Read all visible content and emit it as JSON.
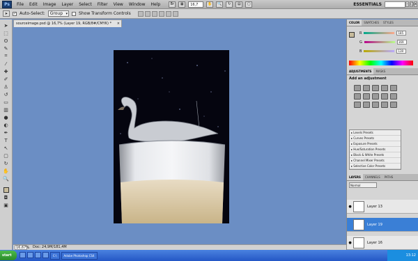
{
  "app": {
    "logo": "Ps"
  },
  "menu": {
    "items": [
      "File",
      "Edit",
      "Image",
      "Layer",
      "Select",
      "Filter",
      "View",
      "Window",
      "Help"
    ],
    "zoom": "16,7",
    "workspace": "ESSENTIALS",
    "window_controls": [
      "-",
      "□",
      "x"
    ]
  },
  "options": {
    "auto_select_label": "Auto-Select:",
    "auto_select_checked": "✓",
    "auto_select_value": "Group",
    "transform_label": "Show Transform Controls"
  },
  "document": {
    "tab_title": "sourceimage.psd @ 16,7% (Layer 19, RGB/8#/CMYK) *",
    "close": "×"
  },
  "status": {
    "zoom": "16,67%",
    "doc_info": "Doc: 24,9M/181,4M"
  },
  "color_panel": {
    "tabs": [
      "COLOR",
      "SWATCHES",
      "STYLES"
    ],
    "fg_color": "#c8bc9c",
    "channels": [
      {
        "label": "R",
        "value": "185"
      },
      {
        "label": "G",
        "value": "169"
      },
      {
        "label": "B",
        "value": "139"
      }
    ]
  },
  "adjustments": {
    "tabs": [
      "ADJUSTMENTS",
      "MASKS"
    ],
    "title": "Add an adjustment",
    "presets": [
      "Levels Presets",
      "Curves Presets",
      "Exposure Presets",
      "Hue/Saturation Presets",
      "Black & White Presets",
      "Channel Mixer Presets",
      "Selective Color Presets"
    ]
  },
  "layers": {
    "tabs": [
      "LAYERS",
      "CHANNELS",
      "PATHS"
    ],
    "blend_mode": "Normal",
    "items": [
      {
        "name": "Layer 13",
        "visible": "●"
      },
      {
        "name": "Layer 19",
        "visible": ""
      },
      {
        "name": "Layer 16",
        "visible": "●"
      }
    ]
  },
  "taskbar": {
    "start": "start",
    "items": [
      "C:\\",
      "Adobe Photoshop CS4"
    ],
    "clock": "13:12"
  }
}
